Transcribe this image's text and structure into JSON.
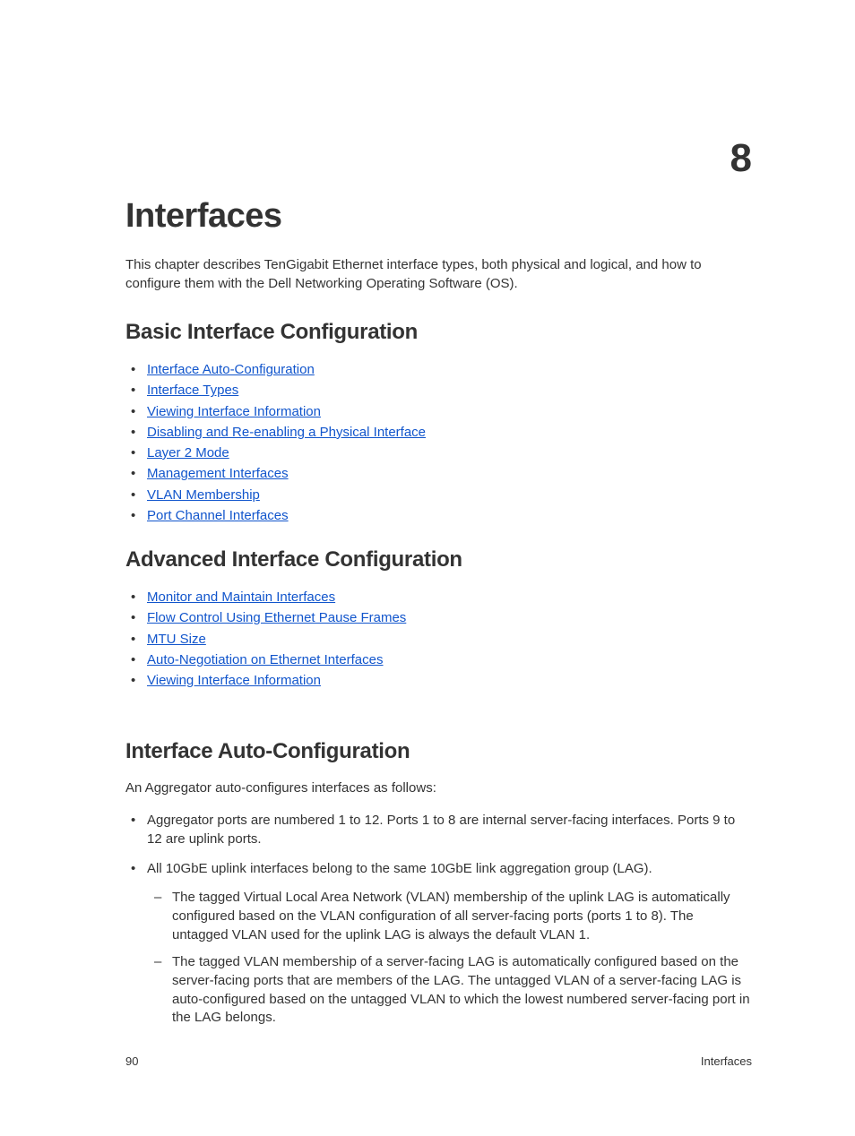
{
  "chapter": {
    "number": "8",
    "title": "Interfaces",
    "intro": "This chapter describes TenGigabit Ethernet interface types, both physical and logical, and how to configure them with the Dell Networking Operating Software (OS)."
  },
  "sections": {
    "basic": {
      "heading": "Basic Interface Configuration",
      "links": [
        "Interface Auto-Configuration",
        "Interface Types",
        "Viewing Interface Information",
        "Disabling and Re-enabling a Physical Interface",
        "Layer 2 Mode",
        "Management Interfaces",
        "VLAN Membership",
        "Port Channel Interfaces"
      ]
    },
    "advanced": {
      "heading": "Advanced Interface Configuration",
      "links": [
        "Monitor and Maintain Interfaces",
        "Flow Control Using Ethernet Pause Frames",
        "MTU Size",
        "Auto-Negotiation on Ethernet Interfaces",
        "Viewing Interface Information"
      ]
    },
    "autoconfig": {
      "heading": "Interface Auto-Configuration",
      "intro": "An Aggregator auto-configures interfaces as follows:",
      "items": [
        {
          "text": "Aggregator ports are numbered 1 to 12. Ports 1 to 8 are internal server-facing interfaces. Ports 9 to 12 are uplink ports."
        },
        {
          "text": "All 10GbE uplink interfaces belong to the same 10GbE link aggregation group (LAG).",
          "sub": [
            "The tagged Virtual Local Area Network (VLAN) membership of the uplink LAG is automatically configured based on the VLAN configuration of all server-facing ports (ports 1 to 8). The untagged VLAN used for the uplink LAG is always the default VLAN 1.",
            "The tagged VLAN membership of a server-facing LAG is automatically configured based on the server-facing ports that are members of the LAG. The untagged VLAN of a server-facing LAG is auto-configured based on the untagged VLAN to which the lowest numbered server-facing port in the LAG belongs."
          ]
        }
      ]
    }
  },
  "footer": {
    "page": "90",
    "section": "Interfaces"
  }
}
